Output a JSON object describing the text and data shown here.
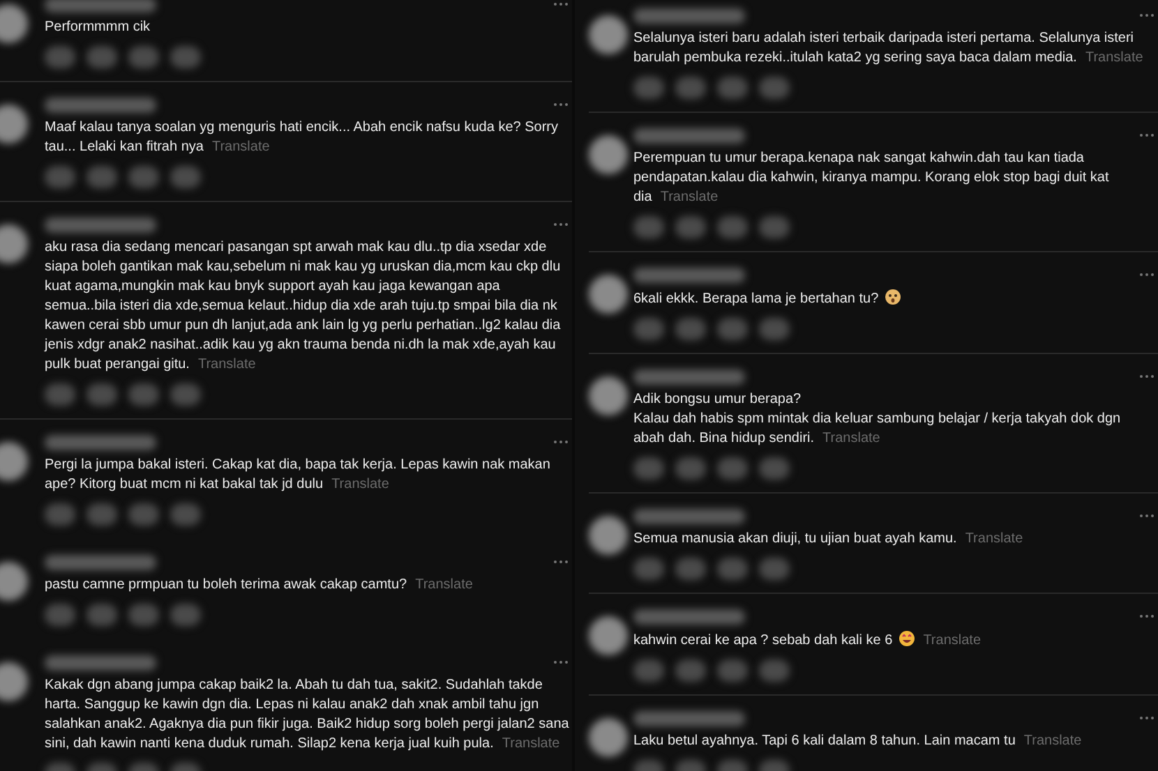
{
  "columns": [
    {
      "comments": [
        {
          "kind": "plain",
          "text": "Performmmm cik"
        },
        {
          "kind": "plain",
          "divider": true,
          "text": "Maaf kalau tanya soalan yg menguris hati encik... Abah encik nafsu kuda ke? Sorry tau... Lelaki kan fitrah nya",
          "translate": "Translate"
        },
        {
          "kind": "plain",
          "divider": true,
          "text": "aku rasa dia sedang mencari pasangan spt arwah mak kau dlu..tp dia xsedar xde siapa boleh gantikan mak kau,sebelum ni mak kau yg uruskan dia,mcm kau ckp dlu kuat agama,mungkin mak kau bnyk support ayah kau jaga kewangan apa semua..bila isteri dia xde,semua kelaut..hidup dia xde arah tuju.tp smpai bila dia nk kawen cerai sbb umur pun dh lanjut,ada ank lain lg yg perlu perhatian..lg2 kalau dia jenis xdgr anak2 nasihat..adik kau yg akn trauma benda ni.dh la mak xde,ayah kau pulk buat perangai gitu.",
          "translate": "Translate"
        },
        {
          "kind": "plain",
          "divider": true,
          "text": "Pergi la jumpa bakal isteri. Cakap kat dia, bapa tak kerja. Lepas kawin nak makan ape? Kitorg buat mcm ni kat bakal tak jd dulu",
          "translate": "Translate"
        },
        {
          "kind": "plain",
          "divider": false,
          "text": "pastu camne prmpuan tu boleh terima awak cakap camtu?",
          "translate": "Translate"
        },
        {
          "kind": "plain",
          "divider": false,
          "text": "Kakak dgn abang jumpa cakap baik2 la. Abah tu dah tua, sakit2. Sudahlah takde harta. Sanggup ke kawin dgn dia. Lepas ni kalau anak2 dah xnak ambil tahu jgn salahkan anak2. Agaknya dia pun fikir juga. Baik2 hidup sorg boleh pergi jalan2 sana sini, dah kawin nanti kena duduk rumah. Silap2 kena kerja jual kuih pula.",
          "translate": "Translate"
        }
      ]
    },
    {
      "comments": [
        {
          "kind": "plain",
          "text": "Selalunya isteri baru adalah isteri terbaik daripada isteri pertama. Selalunya isteri barulah pembuka rezeki..itulah kata2 yg sering saya baca dalam media.",
          "translate": "Translate"
        },
        {
          "kind": "plain",
          "divider": true,
          "text": "Perempuan tu umur berapa.kenapa nak sangat kahwin.dah tau kan tiada pendapatan.kalau dia kahwin, kiranya mampu. Korang elok stop bagi duit kat dia",
          "translate": "Translate"
        },
        {
          "kind": "shocked",
          "divider": true,
          "text": "6kali ekkk. Berapa lama je bertahan tu?"
        },
        {
          "kind": "plain",
          "divider": true,
          "text": "Adik bongsu umur berapa?\nKalau dah habis spm mintak dia keluar sambung belajar / kerja takyah dok dgn abah dah. Bina hidup sendiri.",
          "translate": "Translate"
        },
        {
          "kind": "plain",
          "divider": true,
          "text": "Semua manusia akan diuji, tu ujian buat ayah kamu.",
          "translate": "Translate"
        },
        {
          "kind": "grin",
          "divider": true,
          "text": "kahwin cerai ke apa ? sebab dah kali ke 6",
          "translate": "Translate"
        },
        {
          "kind": "plain",
          "divider": true,
          "text": "Laku betul ayahnya. Tapi 6 kali dalam 8 tahun. Lain macam tu",
          "translate": "Translate"
        }
      ]
    }
  ]
}
